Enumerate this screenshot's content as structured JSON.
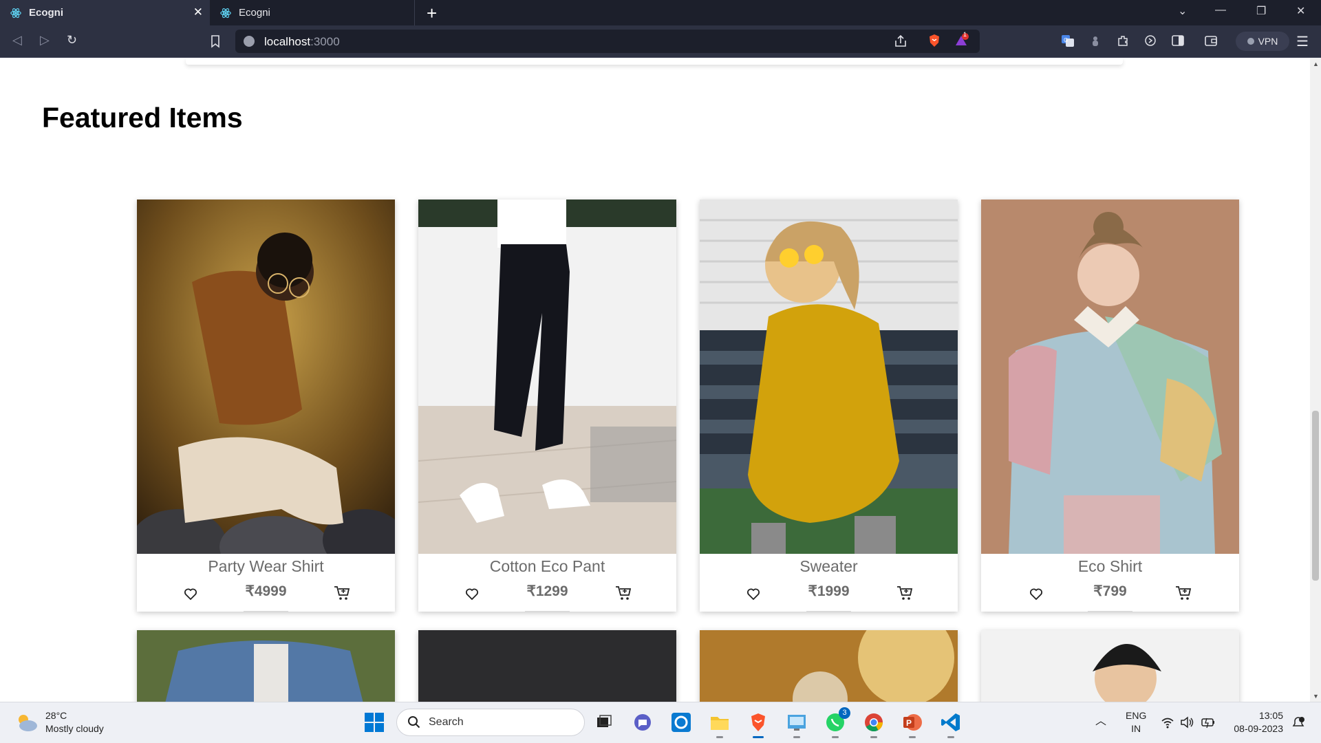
{
  "browser": {
    "tabs": [
      {
        "title": "Ecogni",
        "active": true
      },
      {
        "title": "Ecogni",
        "active": false
      }
    ],
    "url_host": "localhost",
    "url_port": ":3000",
    "alert_count": "1",
    "vpn_label": "VPN"
  },
  "page": {
    "section_title": "Featured Items",
    "products": [
      {
        "name": "Party Wear Shirt",
        "price": "₹4999"
      },
      {
        "name": "Cotton Eco Pant",
        "price": "₹1299"
      },
      {
        "name": "Sweater",
        "price": "₹1999"
      },
      {
        "name": "Eco Shirt",
        "price": "₹799"
      }
    ]
  },
  "taskbar": {
    "weather_temp": "28°C",
    "weather_desc": "Mostly cloudy",
    "search_label": "Search",
    "whatsapp_badge": "3",
    "lang_1": "ENG",
    "lang_2": "IN",
    "time": "13:05",
    "date": "08-09-2023"
  },
  "colors": {
    "chrome_dark": "#1c1f2b",
    "chrome_toolbar": "#2d3142",
    "text_muted": "#6b6b6b",
    "accent_blue": "#0067c0"
  }
}
